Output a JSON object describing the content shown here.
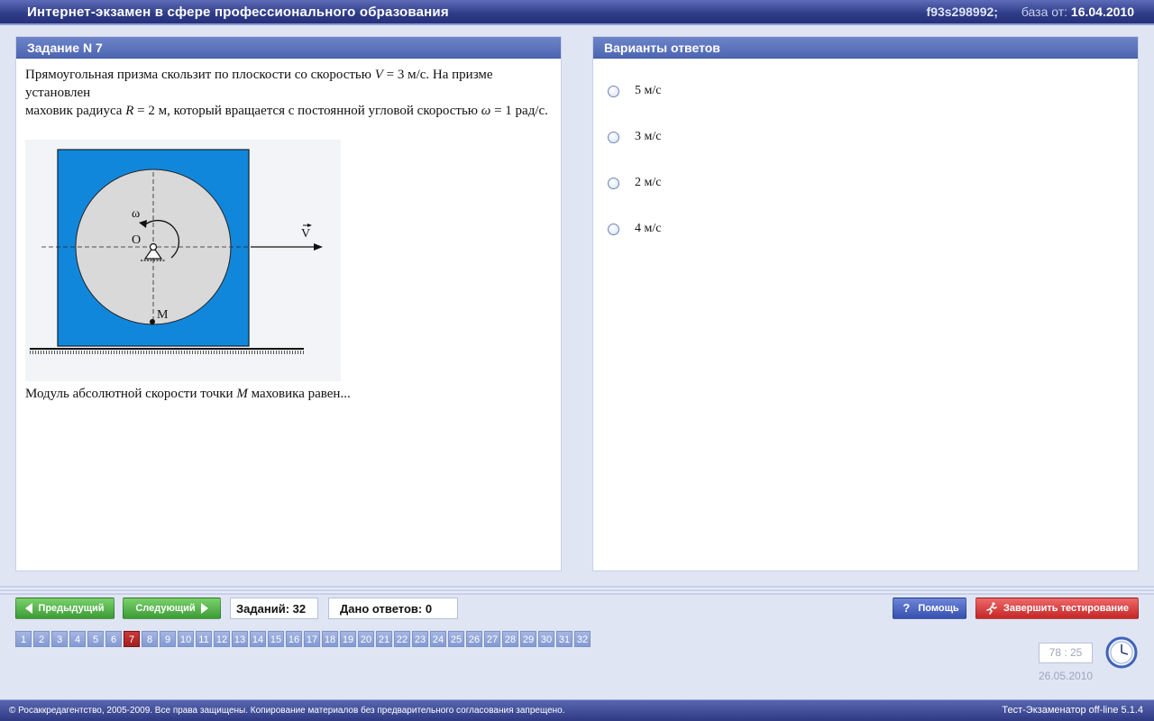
{
  "header": {
    "title": "Интернет-экзамен в сфере профессионального образования",
    "session_code": "f93s298992;",
    "base_label": "база от:",
    "base_date": "16.04.2010"
  },
  "task": {
    "heading": "Задание N 7",
    "text_1": "Прямоугольная призма скользит по плоскости со скоростью",
    "var_v": "V",
    "text_2": "= 3 м/с. На призме установлен",
    "text_3": "маховик радиуса",
    "var_r": "R",
    "text_4": "= 2 м, который вращается с постоянной угловой скоростью",
    "var_omega": "ω",
    "text_5": "= 1 рад/с.",
    "question_1": "Модуль абсолютной скорости точки",
    "var_m": "M",
    "question_2": "маховика равен...",
    "figure": {
      "label_omega": "ω",
      "label_o": "O",
      "label_m": "M",
      "label_v": "V"
    }
  },
  "answers": {
    "heading": "Варианты ответов",
    "options": [
      "5 м/с",
      "3 м/с",
      "2 м/с",
      "4 м/с"
    ]
  },
  "nav": {
    "prev_label": "Предыдущий",
    "next_label": "Следующий",
    "tasks_label": "Заданий: 32",
    "answered_label": "Дано ответов: 0",
    "help_label": "Помощь",
    "finish_label": "Завершить тестирование",
    "current_page": 7,
    "pages": [
      "1",
      "2",
      "3",
      "4",
      "5",
      "6",
      "7",
      "8",
      "9",
      "10",
      "11",
      "12",
      "13",
      "14",
      "15",
      "16",
      "17",
      "18",
      "19",
      "20",
      "21",
      "22",
      "23",
      "24",
      "25",
      "26",
      "27",
      "28",
      "29",
      "30",
      "31",
      "32"
    ]
  },
  "timer": {
    "value": "78 : 25",
    "date": "26.05.2010"
  },
  "footer": {
    "copyright": "© Росаккредагентство, 2005-2009. Все права защищены. Копирование материалов без предварительного согласования запрещено.",
    "version": "Тест-Экзаменатор off-line 5.1.4"
  },
  "colors": {
    "prism": "#1187dc",
    "flywheel": "#d9d9d9",
    "current_page": "#b52b2b"
  }
}
